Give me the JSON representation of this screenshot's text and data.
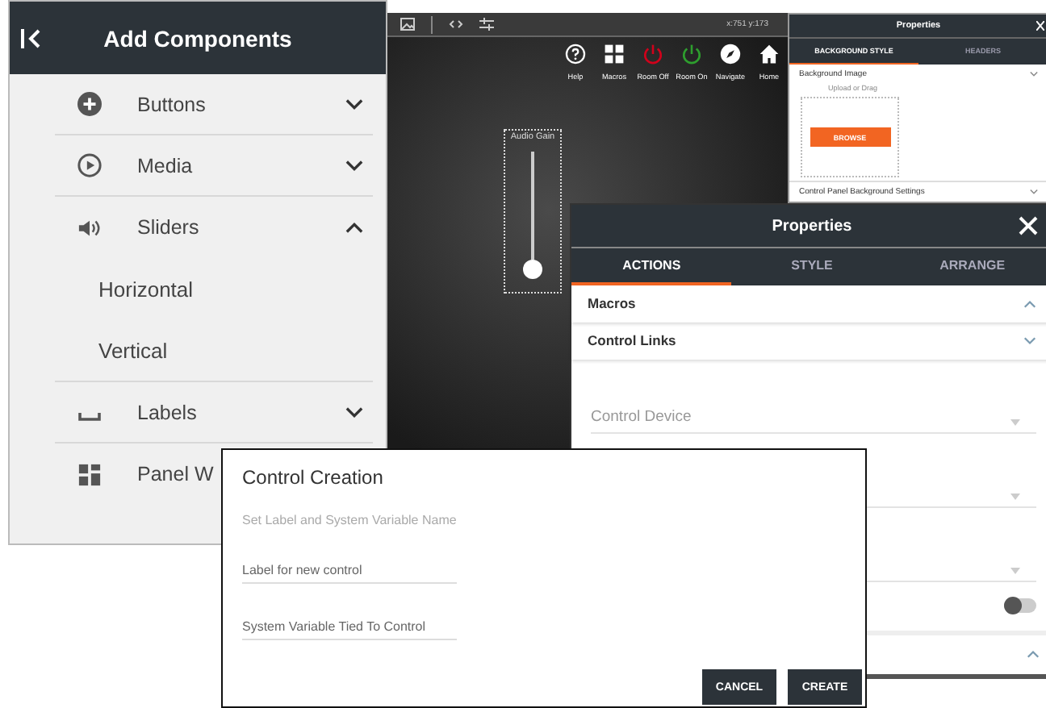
{
  "components_panel": {
    "title": "Add Components",
    "categories": [
      {
        "kind": "buttons",
        "label": "Buttons",
        "expanded": false
      },
      {
        "kind": "media",
        "label": "Media",
        "expanded": false
      },
      {
        "kind": "sliders",
        "label": "Sliders",
        "expanded": true,
        "children": [
          {
            "label": "Horizontal"
          },
          {
            "label": "Vertical"
          }
        ]
      },
      {
        "kind": "labels",
        "label": "Labels",
        "expanded": false
      },
      {
        "kind": "panels",
        "label": "Panel W"
      }
    ]
  },
  "canvas": {
    "coordinates": "x:751 y:173",
    "actions": [
      {
        "kind": "help",
        "label": "Help",
        "color": "#ffffff"
      },
      {
        "kind": "macros",
        "label": "Macros",
        "color": "#ffffff"
      },
      {
        "kind": "power",
        "label": "Room Off",
        "color": "#d0021b"
      },
      {
        "kind": "power",
        "label": "Room On",
        "color": "#2e9e2e"
      },
      {
        "kind": "navigate",
        "label": "Navigate",
        "color": "#ffffff"
      },
      {
        "kind": "home",
        "label": "Home",
        "color": "#ffffff"
      }
    ],
    "slider": {
      "label": "Audio Gain",
      "level": 0
    }
  },
  "background_properties": {
    "title": "Properties",
    "tabs": [
      {
        "label": "BACKGROUND STYLE",
        "selected": true
      },
      {
        "label": "HEADERS",
        "selected": false
      }
    ],
    "image_section": {
      "title": "Background Image",
      "hint": "Upload or Drag",
      "button": "BROWSE"
    },
    "settings_section": {
      "title": "Control Panel Background Settings"
    }
  },
  "properties_dialog": {
    "title": "Properties",
    "tabs": [
      {
        "label": "ACTIONS",
        "selected": true
      },
      {
        "label": "STYLE",
        "selected": false
      },
      {
        "label": "ARRANGE",
        "selected": false
      }
    ],
    "sections": [
      {
        "title": "Macros",
        "expanded": true
      },
      {
        "title": "Control Links",
        "expanded": false
      }
    ],
    "fields": [
      {
        "kind": "select",
        "placeholder": "Control Device"
      },
      {
        "kind": "select"
      },
      {
        "kind": "select"
      },
      {
        "kind": "toggle",
        "on": false
      }
    ],
    "footer_section": {
      "expanded": true
    }
  },
  "control_creation": {
    "title": "Control Creation",
    "subtitle": "Set Label and System Variable Name",
    "fields": [
      {
        "placeholder": "Label for new control"
      },
      {
        "placeholder": "System Variable Tied To Control"
      }
    ],
    "buttons": [
      "CANCEL",
      "CREATE"
    ]
  }
}
